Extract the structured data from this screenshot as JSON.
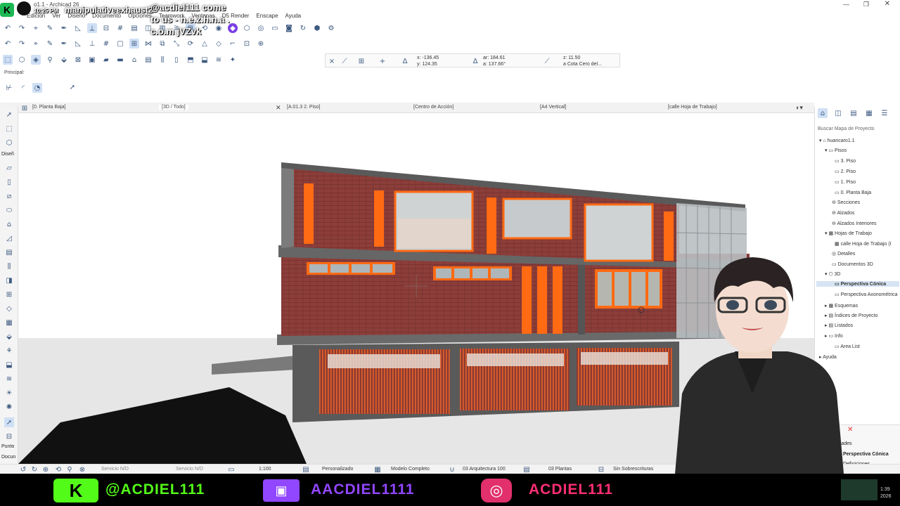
{
  "window": {
    "title": "o1.1 - Archicad 26"
  },
  "overlay": {
    "time": "10:25 PM",
    "username": "manipulativeexhaust2",
    "message_line1": "@acdiel111 come",
    "message_line2": "to us - n.e.z.h.n.a .",
    "message_line3": "c.o.m jVZvk"
  },
  "menu": {
    "items": [
      "Edición",
      "Ver",
      "Diseño",
      "Documento",
      "Opciones",
      "Teamwork",
      "Ventanas",
      "D5 Render",
      "Enscape",
      "Ayuda"
    ]
  },
  "info_box": {
    "x": "x: -136.45",
    "y": "y: 124.35",
    "ar": "ar: 184.61",
    "a": "a: 137.66°",
    "z": "z: 11.50",
    "ref": "a Cota Cero del..."
  },
  "left_labels": {
    "principal": "Principal:",
    "diseno": "Diseñ",
    "punto": "Punto",
    "docu": "Docun"
  },
  "tabs": [
    {
      "label": "[0. Planta Baja]"
    },
    {
      "label": "[3D / Todo]"
    },
    {
      "label": "[A.01.3 2. Piso]"
    },
    {
      "label": "[Centro de Acción]"
    },
    {
      "label": "[A4 Vertical]"
    },
    {
      "label": "[calle Hoja de Trabajo]"
    }
  ],
  "navigator": {
    "search_placeholder": "Buscar Mapa de Proyecto",
    "items": [
      {
        "label": "huancaro1.1"
      },
      {
        "label": "Pisos"
      },
      {
        "label": "3. Piso"
      },
      {
        "label": "2. Piso"
      },
      {
        "label": "1. Piso"
      },
      {
        "label": "0. Planta Baja"
      },
      {
        "label": "Secciones"
      },
      {
        "label": "Alzados"
      },
      {
        "label": "Alzados Interiores"
      },
      {
        "label": "Hojas de Trabajo"
      },
      {
        "label": "calle Hoja de Trabajo (I"
      },
      {
        "label": "Detalles"
      },
      {
        "label": "Documentos 3D"
      },
      {
        "label": "3D"
      },
      {
        "label": "Perspectiva Cónica"
      },
      {
        "label": "Perspectiva Axonométrica"
      },
      {
        "label": "Esquemas"
      },
      {
        "label": "Índices de Proyecto"
      },
      {
        "label": "Listados"
      },
      {
        "label": "Info"
      },
      {
        "label": "Area List"
      },
      {
        "label": "Ayuda"
      }
    ],
    "props_title": "iedades",
    "props_value": "Perspectiva Cónica",
    "props_def": "Definiciones"
  },
  "status": {
    "serv1": "Servicio N/D",
    "serv2": "Servicio N/D",
    "scale": "1:100",
    "pen": "Personalizado",
    "model": "Modelo Completo",
    "arch": "03 Arquitectura 100",
    "floors": "03 Plantas",
    "overrides": "Sin Sobrescrituras"
  },
  "clock": {
    "time": "1:39",
    "year": "2026"
  },
  "banner": {
    "kick": "@ACDIEL111",
    "twitch": "AACDIEL1111",
    "instagram": "ACDIEL111"
  },
  "colors": {
    "kick": "#53fc18",
    "twitch": "#9146ff",
    "instagram": "#ff2f72",
    "brick": "#8b3c38",
    "accent_orange": "#ff6a13"
  }
}
